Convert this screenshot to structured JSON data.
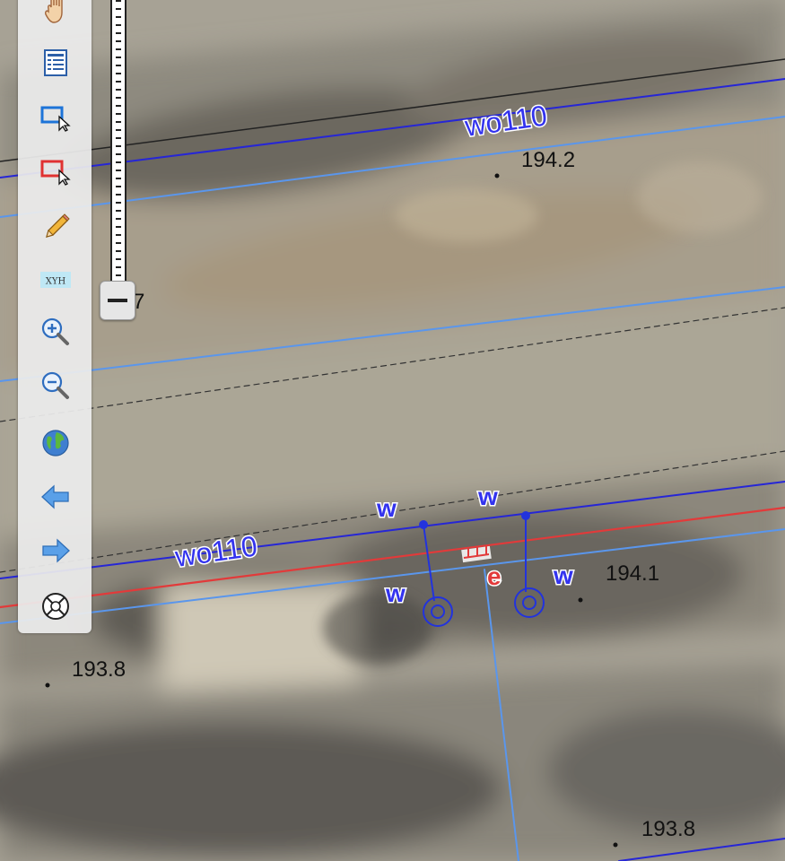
{
  "map": {
    "labels": {
      "line_upper": "wo110",
      "line_lower": "wo110",
      "elev_1": "194.2",
      "elev_2": "194.1",
      "elev_3": "193.8",
      "elev_4": "193.8",
      "elev_partial": "7",
      "w1": "w",
      "w2": "w",
      "w3": "w",
      "w4": "w",
      "e": "e"
    }
  },
  "toolbar": {
    "tools": [
      "pan-hand-icon",
      "layer-list-icon",
      "select-box-icon",
      "deselect-box-icon",
      "edit-pencil-icon",
      "coordinate-xyh-icon",
      "zoom-in-icon",
      "zoom-out-icon",
      "full-extent-globe-icon",
      "back-arrow-icon",
      "forward-arrow-icon",
      "close-circle-icon"
    ],
    "xyh_label": "XYH"
  },
  "colors": {
    "dark_blue_line": "#2626d6",
    "light_blue_line": "#5a96ec",
    "red_line": "#e23a3a",
    "label_blue": "#3333ee"
  }
}
